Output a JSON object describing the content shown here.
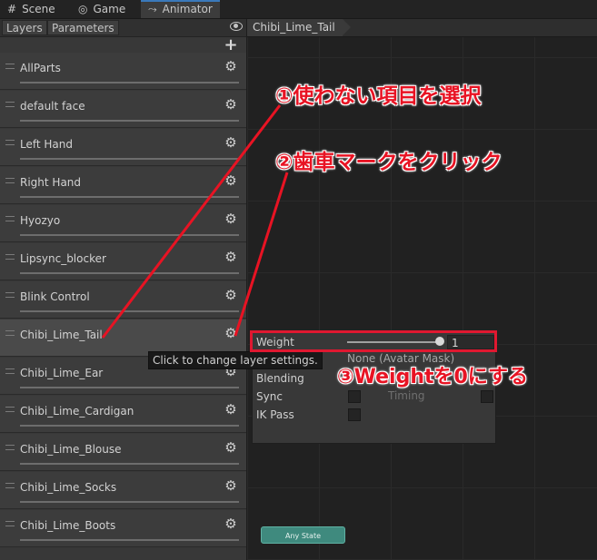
{
  "window_tabs": [
    {
      "icon": "#",
      "label": "Scene"
    },
    {
      "icon": "◎",
      "label": "Game"
    },
    {
      "icon": "⤳",
      "label": "Animator"
    }
  ],
  "left_panel": {
    "tabs": [
      "Layers",
      "Parameters"
    ],
    "add_label": "+",
    "layers": [
      "AllParts",
      "default face",
      "Left Hand",
      "Right Hand",
      "Hyozyo",
      "Lipsync_blocker",
      "Blink Control",
      "Chibi_Lime_Tail",
      "Chibi_Lime_Ear",
      "Chibi_Lime_Cardigan",
      "Chibi_Lime_Blouse",
      "Chibi_Lime_Socks",
      "Chibi_Lime_Boots"
    ],
    "selected_layer": "Chibi_Lime_Tail",
    "tooltip": "Click to change layer settings."
  },
  "breadcrumb": "Chibi_Lime_Tail",
  "layer_settings": {
    "weight_label": "Weight",
    "weight_value": "1",
    "weight_fraction": 1.0,
    "mask_value": "None (Avatar Mask)",
    "blending_label": "Blending",
    "sync_label": "Sync",
    "timing_label": "Timing",
    "ik_pass_label": "IK Pass"
  },
  "graph": {
    "any_state_label": "Any State"
  },
  "annotations": {
    "step1": "①使わない項目を選択",
    "step2": "②歯車マークをクリック",
    "step3": "③Weightを0にする",
    "color": "#e81323"
  }
}
